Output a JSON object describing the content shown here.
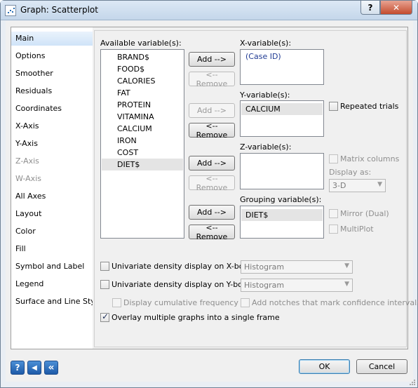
{
  "window": {
    "title": "Graph: Scatterplot",
    "help_label": "?",
    "close_label": "✕"
  },
  "sidebar": {
    "items": [
      {
        "label": "Main",
        "state": "selected"
      },
      {
        "label": "Options",
        "state": "normal"
      },
      {
        "label": "Smoother",
        "state": "normal"
      },
      {
        "label": "Residuals",
        "state": "normal"
      },
      {
        "label": "Coordinates",
        "state": "normal"
      },
      {
        "label": "X-Axis",
        "state": "normal"
      },
      {
        "label": "Y-Axis",
        "state": "normal"
      },
      {
        "label": "Z-Axis",
        "state": "disabled"
      },
      {
        "label": "W-Axis",
        "state": "disabled"
      },
      {
        "label": "All Axes",
        "state": "normal"
      },
      {
        "label": "Layout",
        "state": "normal"
      },
      {
        "label": "Color",
        "state": "normal"
      },
      {
        "label": "Fill",
        "state": "normal"
      },
      {
        "label": "Symbol and Label",
        "state": "normal"
      },
      {
        "label": "Legend",
        "state": "normal"
      },
      {
        "label": "Surface and Line Style",
        "state": "normal"
      }
    ]
  },
  "main": {
    "available": {
      "label": "Available variable(s):",
      "items": [
        "BRAND$",
        "FOOD$",
        "CALORIES",
        "FAT",
        "PROTEIN",
        "VITAMINA",
        "CALCIUM",
        "IRON",
        "COST",
        "DIET$"
      ],
      "selected": "DIET$"
    },
    "x": {
      "label": "X-variable(s):",
      "items": [
        "(Case ID)"
      ],
      "add_label": "Add -->",
      "remove_label": "<-- Remove"
    },
    "y": {
      "label": "Y-variable(s):",
      "items": [
        "CALCIUM"
      ],
      "add_label": "Add -->",
      "remove_label": "<-- Remove",
      "repeated_trials": "Repeated trials"
    },
    "z": {
      "label": "Z-variable(s):",
      "items": [],
      "add_label": "Add -->",
      "remove_label": "<-- Remove",
      "matrix_columns": "Matrix columns",
      "display_as_label": "Display as:",
      "display_as_value": "3-D"
    },
    "grouping": {
      "label": "Grouping variable(s):",
      "items": [
        "DIET$"
      ],
      "add_label": "Add -->",
      "remove_label": "<-- Remove",
      "mirror": "Mirror (Dual)",
      "multiplot": "MultiPlot"
    },
    "density_x": {
      "label": "Univariate density display on X-border",
      "value": "Histogram"
    },
    "density_y": {
      "label": "Univariate density display on Y-border",
      "value": "Histogram"
    },
    "cumulative": "Display cumulative frequency",
    "notches": "Add notches that mark confidence intervals",
    "overlay": {
      "label": "Overlay multiple graphs into a single frame",
      "checked": true
    }
  },
  "footer": {
    "ok": "OK",
    "cancel": "Cancel",
    "help_glyph": "?",
    "back_glyph": "◀",
    "back_all_glyph": "«"
  }
}
